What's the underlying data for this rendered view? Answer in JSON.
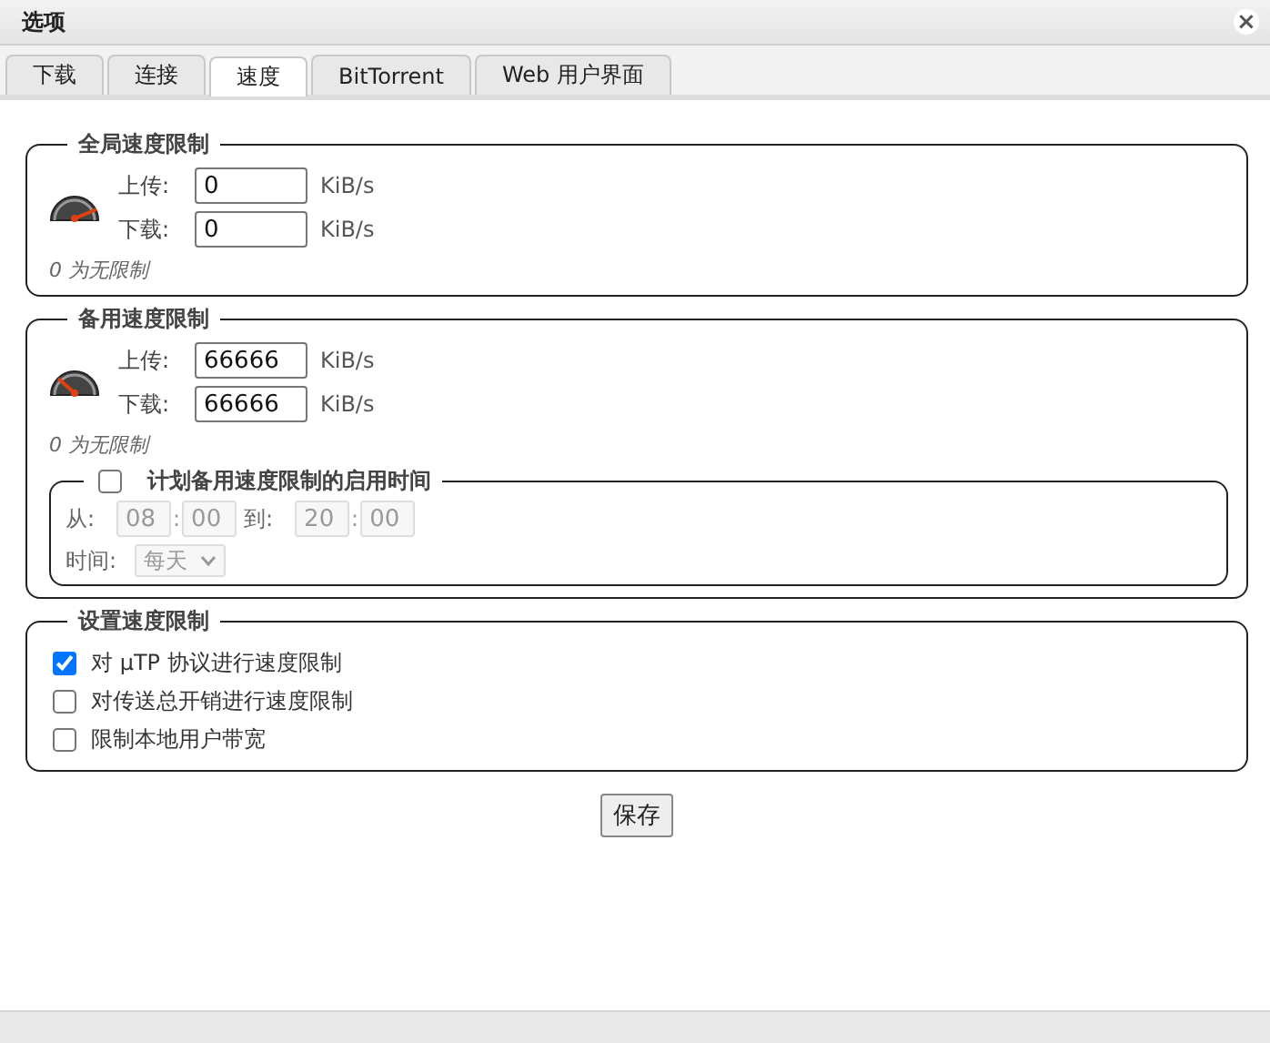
{
  "window": {
    "title": "选项",
    "close": "×"
  },
  "tabs": [
    {
      "label": "下载",
      "selected": false
    },
    {
      "label": "连接",
      "selected": false
    },
    {
      "label": "速度",
      "selected": true
    },
    {
      "label": "BitTorrent",
      "selected": false
    },
    {
      "label": "Web 用户界面",
      "selected": false
    }
  ],
  "global_limits": {
    "legend": "全局速度限制",
    "upload_label": "上传:",
    "upload_value": "0",
    "download_label": "下载:",
    "download_value": "0",
    "upload_unit": "KiB/s",
    "download_unit": "KiB/s",
    "hint": "0 为无限制"
  },
  "alt_limits": {
    "legend": "备用速度限制",
    "upload_label": "上传:",
    "upload_value": "66666",
    "download_label": "下载:",
    "download_value": "66666",
    "upload_unit": "KiB/s",
    "download_unit": "KiB/s",
    "hint": "0 为无限制",
    "schedule": {
      "legend": "计划备用速度限制的启用时间",
      "checked": false,
      "from_label": "从:",
      "from_hour": "08",
      "from_separator": ":",
      "from_minute": "00",
      "to_label": "到:",
      "to_hour": "20",
      "to_separator": ":",
      "to_minute": "00",
      "days_label": "时间:",
      "days_value": "每天"
    }
  },
  "rate_settings": {
    "legend": "设置速度限制",
    "options": [
      {
        "label": "对 µTP 协议进行速度限制",
        "checked": true
      },
      {
        "label": "对传送总开销进行速度限制",
        "checked": false
      },
      {
        "label": "限制本地用户带宽",
        "checked": false
      }
    ]
  },
  "save_button": "保存"
}
